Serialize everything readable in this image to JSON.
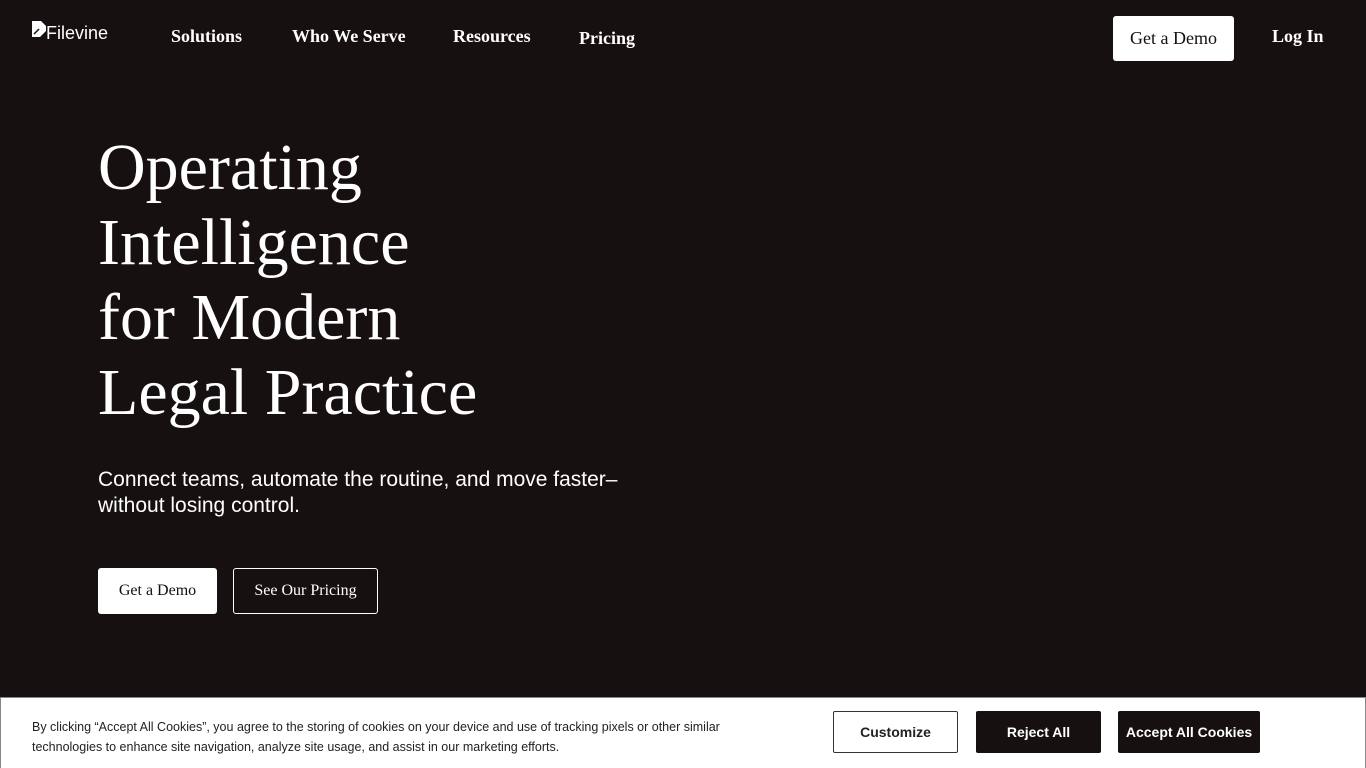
{
  "header": {
    "logo_text": "Filevine",
    "nav": [
      "Solutions",
      "Who We Serve",
      "Resources",
      "Pricing"
    ],
    "demo_button": "Get a Demo",
    "login": "Log In"
  },
  "hero": {
    "title_lines": [
      "Operating",
      "Intelligence",
      "for Modern",
      "Legal Practice"
    ],
    "subtitle_lines": [
      "Connect teams, automate the routine, and move faster–",
      "without losing control."
    ],
    "primary_button": "Get a Demo",
    "secondary_button": "See Our Pricing"
  },
  "cookie_banner": {
    "text_lines": [
      "By clicking “Accept All Cookies”, you agree to the storing of cookies on your device and use of tracking pixels or other similar",
      "technologies to enhance site navigation, analyze site usage, and assist in our marketing efforts."
    ],
    "customize": "Customize",
    "reject": "Reject All",
    "accept": "Accept All Cookies"
  },
  "colors": {
    "background": "#161010",
    "text": "#ffffff",
    "button_light": "#ffffff",
    "button_dark": "#161010"
  }
}
